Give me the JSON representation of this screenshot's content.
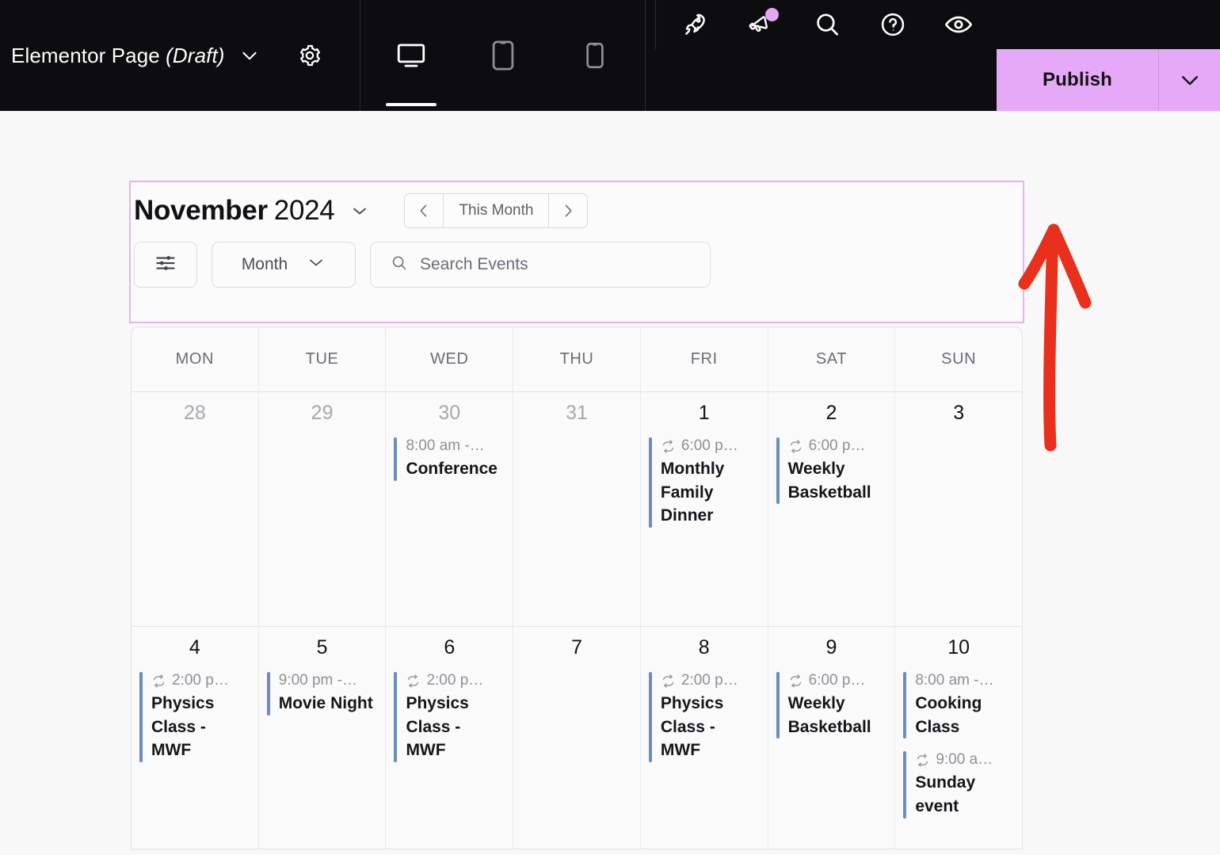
{
  "editor": {
    "page_title": "Elementor Page",
    "page_status": "(Draft)",
    "title_caret_icon": "chevron-down-icon",
    "settings_icon": "gear-icon",
    "devices": [
      {
        "name": "desktop",
        "icon": "desktop-icon",
        "active": true
      },
      {
        "name": "tablet",
        "icon": "tablet-icon",
        "active": false
      },
      {
        "name": "mobile",
        "icon": "mobile-icon",
        "active": false
      }
    ],
    "toolbar_icons": [
      {
        "name": "launchpad-icon",
        "glyph": "rocket"
      },
      {
        "name": "notifications-icon",
        "glyph": "megaphone",
        "badge": true
      },
      {
        "name": "finder-search-icon",
        "glyph": "search"
      },
      {
        "name": "help-icon",
        "glyph": "question"
      },
      {
        "name": "preview-icon",
        "glyph": "eye"
      }
    ],
    "publish_label": "Publish",
    "publish_caret_icon": "chevron-down-icon",
    "accent_color": "#e6a9f7",
    "selection_color": "#e6b3f2",
    "annotation_color": "#e8301c"
  },
  "calendar": {
    "month_name": "November",
    "year": "2024",
    "month_caret_icon": "chevron-down-icon",
    "nav": {
      "prev_icon": "chevron-left-icon",
      "this_month_label": "This Month",
      "next_icon": "chevron-right-icon"
    },
    "filter_icon": "sliders-icon",
    "view_label": "Month",
    "view_caret_icon": "chevron-down-icon",
    "search": {
      "icon": "search-icon",
      "placeholder": "Search Events",
      "value": ""
    },
    "weekday_headers": [
      "MON",
      "TUE",
      "WED",
      "THU",
      "FRI",
      "SAT",
      "SUN"
    ],
    "event_bar_color": "#6a8cc0",
    "recurring_icon": "repeat-icon",
    "weeks": [
      [
        {
          "date": "28",
          "other_month": true,
          "events": []
        },
        {
          "date": "29",
          "other_month": true,
          "events": []
        },
        {
          "date": "30",
          "other_month": true,
          "events": [
            {
              "time": "8:00 am -…",
              "title": "Conference",
              "recurring": false
            }
          ]
        },
        {
          "date": "31",
          "other_month": true,
          "events": []
        },
        {
          "date": "1",
          "other_month": false,
          "events": [
            {
              "time": "6:00 p…",
              "title": "Monthly Family Dinner",
              "recurring": true
            }
          ]
        },
        {
          "date": "2",
          "other_month": false,
          "events": [
            {
              "time": "6:00 p…",
              "title": "Weekly Basketball",
              "recurring": true
            }
          ]
        },
        {
          "date": "3",
          "other_month": false,
          "events": []
        }
      ],
      [
        {
          "date": "4",
          "other_month": false,
          "events": [
            {
              "time": "2:00 p…",
              "title": "Physics Class - MWF",
              "recurring": true
            }
          ]
        },
        {
          "date": "5",
          "other_month": false,
          "events": [
            {
              "time": "9:00 pm -…",
              "title": "Movie Night",
              "recurring": false
            }
          ]
        },
        {
          "date": "6",
          "other_month": false,
          "events": [
            {
              "time": "2:00 p…",
              "title": "Physics Class - MWF",
              "recurring": true
            }
          ]
        },
        {
          "date": "7",
          "other_month": false,
          "events": []
        },
        {
          "date": "8",
          "other_month": false,
          "events": [
            {
              "time": "2:00 p…",
              "title": "Physics Class - MWF",
              "recurring": true
            }
          ]
        },
        {
          "date": "9",
          "other_month": false,
          "events": [
            {
              "time": "6:00 p…",
              "title": "Weekly Basketball",
              "recurring": true
            }
          ]
        },
        {
          "date": "10",
          "other_month": false,
          "events": [
            {
              "time": "8:00 am -…",
              "title": "Cooking Class",
              "recurring": false
            },
            {
              "time": "9:00 a…",
              "title": "Sunday event",
              "recurring": true
            }
          ]
        }
      ]
    ]
  }
}
